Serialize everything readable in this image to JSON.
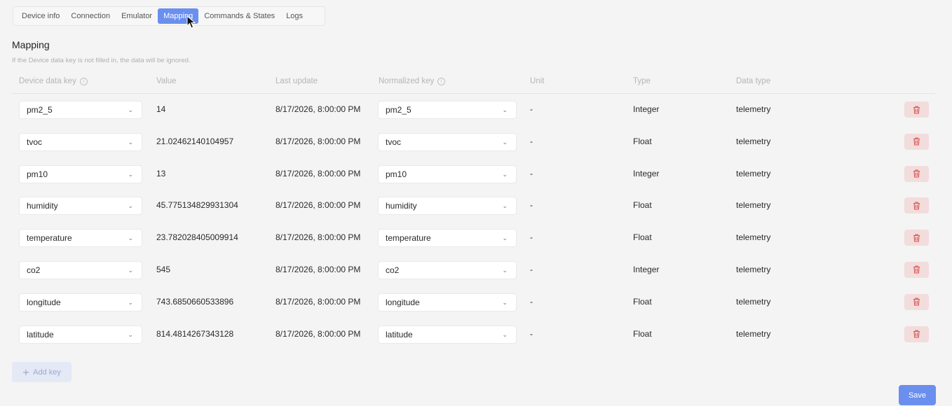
{
  "tabs": [
    {
      "label": "Device info",
      "active": false
    },
    {
      "label": "Connection",
      "active": false
    },
    {
      "label": "Emulator",
      "active": false
    },
    {
      "label": "Mapping",
      "active": true
    },
    {
      "label": "Commands & States",
      "active": false
    },
    {
      "label": "Logs",
      "active": false
    }
  ],
  "section": {
    "title": "Mapping",
    "hint": "If the Device data key is not filled in, the data will be ignored."
  },
  "columns": {
    "device_key": "Device data key",
    "value": "Value",
    "last_update": "Last update",
    "normalized_key": "Normalized key",
    "unit": "Unit",
    "type": "Type",
    "data_type": "Data type"
  },
  "rows": [
    {
      "device_key": "pm2_5",
      "value": "14",
      "last_update": "8/17/2026, 8:00:00 PM",
      "normalized_key": "pm2_5",
      "unit": "-",
      "type": "Integer",
      "data_type": "telemetry"
    },
    {
      "device_key": "tvoc",
      "value": "21.02462140104957",
      "last_update": "8/17/2026, 8:00:00 PM",
      "normalized_key": "tvoc",
      "unit": "-",
      "type": "Float",
      "data_type": "telemetry"
    },
    {
      "device_key": "pm10",
      "value": "13",
      "last_update": "8/17/2026, 8:00:00 PM",
      "normalized_key": "pm10",
      "unit": "-",
      "type": "Integer",
      "data_type": "telemetry"
    },
    {
      "device_key": "humidity",
      "value": "45.775134829931304",
      "last_update": "8/17/2026, 8:00:00 PM",
      "normalized_key": "humidity",
      "unit": "-",
      "type": "Float",
      "data_type": "telemetry"
    },
    {
      "device_key": "temperature",
      "value": "23.782028405009914",
      "last_update": "8/17/2026, 8:00:00 PM",
      "normalized_key": "temperature",
      "unit": "-",
      "type": "Float",
      "data_type": "telemetry"
    },
    {
      "device_key": "co2",
      "value": "545",
      "last_update": "8/17/2026, 8:00:00 PM",
      "normalized_key": "co2",
      "unit": "-",
      "type": "Integer",
      "data_type": "telemetry"
    },
    {
      "device_key": "longitude",
      "value": "743.6850660533896",
      "last_update": "8/17/2026, 8:00:00 PM",
      "normalized_key": "longitude",
      "unit": "-",
      "type": "Float",
      "data_type": "telemetry"
    },
    {
      "device_key": "latitude",
      "value": "814.4814267343128",
      "last_update": "8/17/2026, 8:00:00 PM",
      "normalized_key": "latitude",
      "unit": "-",
      "type": "Float",
      "data_type": "telemetry"
    }
  ],
  "actions": {
    "add_key": "Add key",
    "save": "Save"
  },
  "icons": {
    "info": "info-icon",
    "chevron": "chevron-down-icon",
    "delete": "trash-icon",
    "add": "plus-icon"
  },
  "colors": {
    "accent": "#6a8fee",
    "delete_bg": "#f3dcdc",
    "delete_icon": "#d9534f"
  }
}
